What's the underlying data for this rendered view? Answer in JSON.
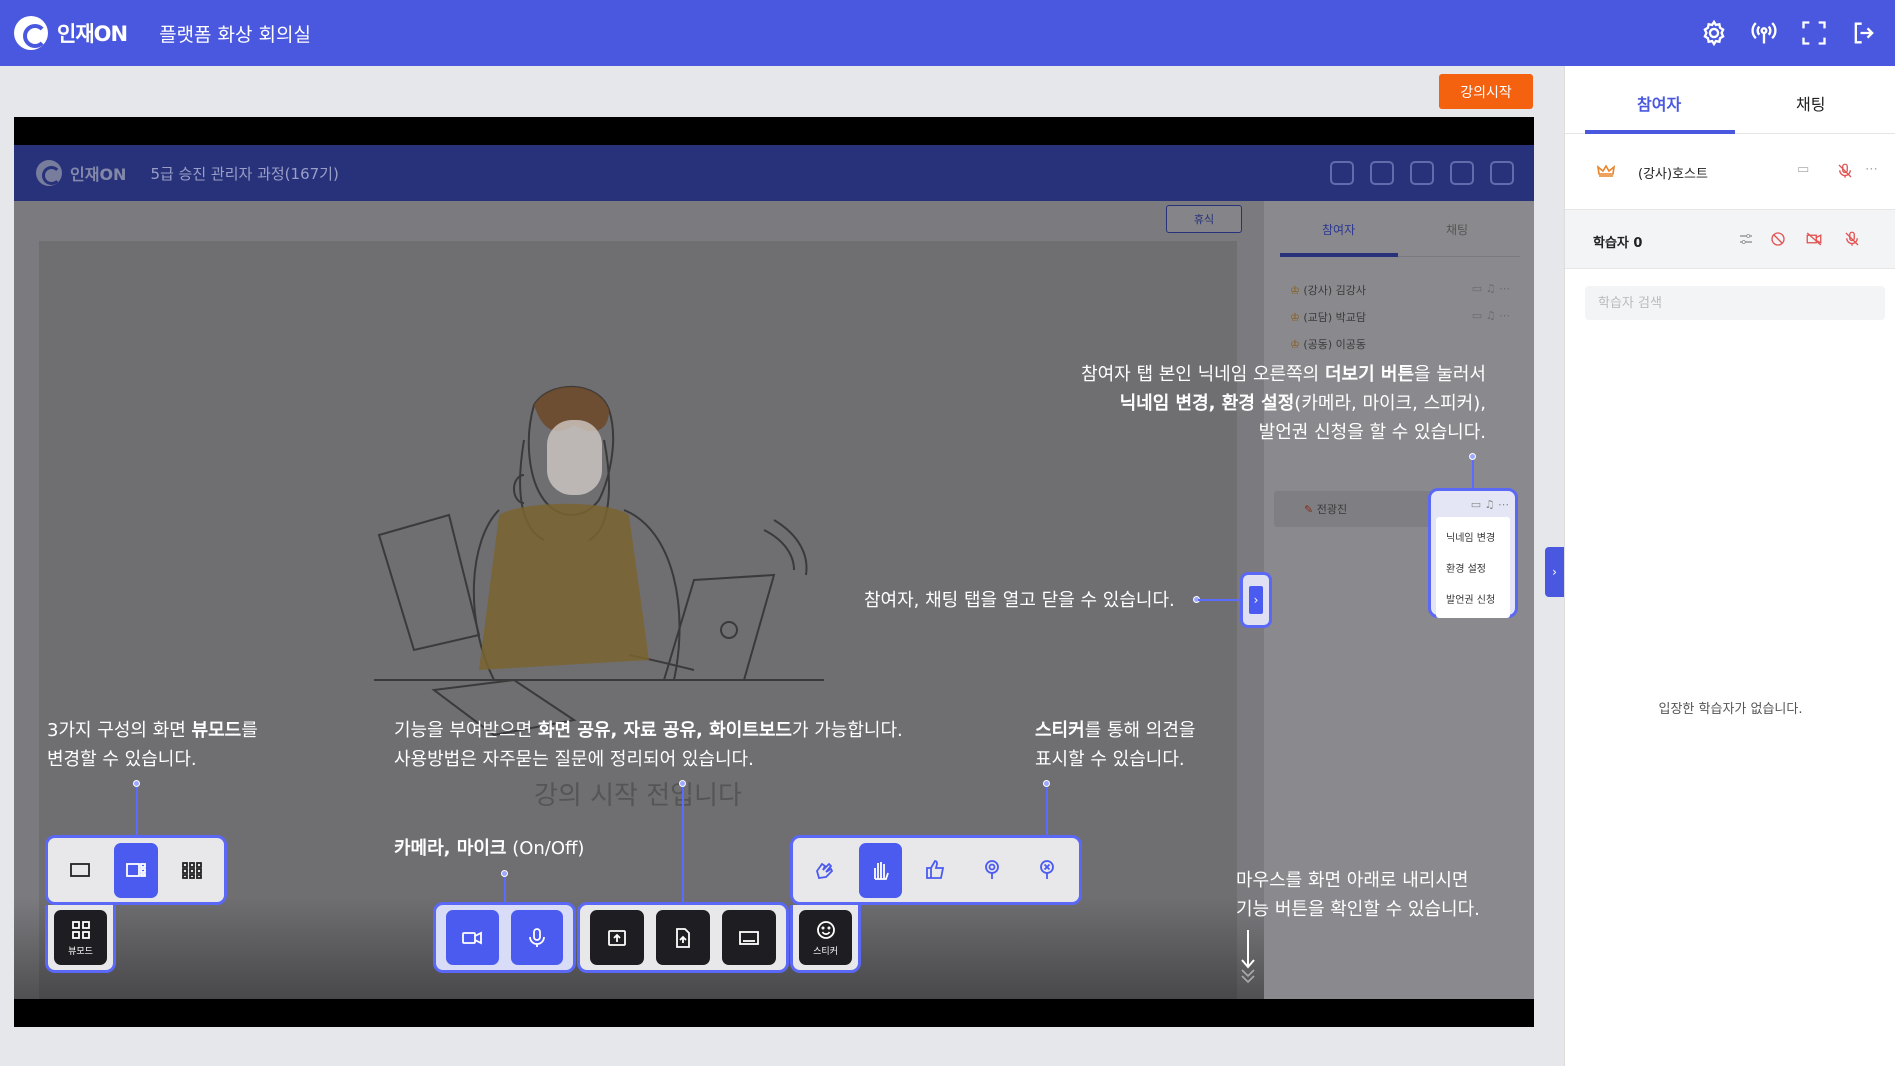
{
  "header": {
    "logo_text": "인재ON",
    "title": "플랫폼 화상 회의실",
    "icons": [
      "gear-icon",
      "broadcast-icon",
      "fullscreen-icon",
      "exit-icon"
    ]
  },
  "start_button": "강의시작",
  "inner_screen": {
    "logo_text": "인재ON",
    "title": "5급 승진 관리자 과정(167기)",
    "break_button": "휴식",
    "tabs": [
      "참여자",
      "채팅"
    ],
    "participants": [
      {
        "label": "(강사) 김강사"
      },
      {
        "label": "(교담) 박교담"
      },
      {
        "label": "(공동) 이공동"
      }
    ],
    "me_label": "전광진",
    "bottom_text": "강의 시작 전입니다"
  },
  "guides": {
    "more_line1_a": "참여자 탭 본인 닉네임 오른쪽의 ",
    "more_line1_b": "더보기 버튼",
    "more_line1_c": "을 눌러서",
    "more_line2_a": "닉네임 변경, 환경 설정",
    "more_line2_b": "(카메라, 마이크, 스피커),",
    "more_line3": "발언권 신청을 할 수 있습니다.",
    "toggle": "참여자, 채팅 탭을 열고 닫을 수 있습니다.",
    "view_line1_a": "3가지 구성의 화면 ",
    "view_line1_b": "뷰모드",
    "view_line1_c": "를",
    "view_line2": "변경할 수 있습니다.",
    "share_line1_a": "기능을 부여받으면 ",
    "share_line1_b": "화면 공유, 자료 공유, 화이트보드",
    "share_line1_c": "가 가능합니다.",
    "share_line2": "사용방법은 자주묻는 질문에 정리되어 있습니다.",
    "sticker_line1_a": "스티커",
    "sticker_line1_b": "를 통해 의견을",
    "sticker_line2": "표시할 수 있습니다.",
    "cam_a": "카메라, 마이크",
    "cam_b": " (On/Off)",
    "mouse_line1": "마우스를 화면 아래로 내리시면",
    "mouse_line2": "기능 버튼을 확인할 수 있습니다."
  },
  "more_menu": [
    "닉네임 변경",
    "환경 설정",
    "발언권 신청"
  ],
  "controls": {
    "view_label": "뷰모드",
    "sticker_label": "스티커"
  },
  "side": {
    "tabs": [
      "참여자",
      "채팅"
    ],
    "host_name": "(강사)호스트",
    "learner_label": "학습자",
    "learner_count": "0",
    "search_placeholder": "학습자 검색",
    "empty_text": "입장한 학습자가 없습니다."
  },
  "colors": {
    "brand": "#4a58df",
    "accent_orange": "#f4610f",
    "highlight": "#5a68f5"
  }
}
